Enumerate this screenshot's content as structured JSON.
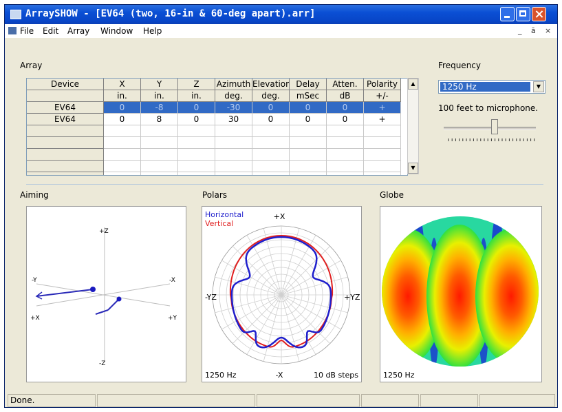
{
  "window": {
    "title": "ArraySHOW - [EV64 (two, 16-in & 60-deg apart).arr]"
  },
  "menu": [
    "File",
    "Edit",
    "Array",
    "Window",
    "Help"
  ],
  "mdi_controls": {
    "minimize": "_",
    "restore": "ā",
    "close": "×"
  },
  "array": {
    "label": "Array",
    "columns": [
      {
        "name": "Device",
        "unit": ""
      },
      {
        "name": "X",
        "unit": "in."
      },
      {
        "name": "Y",
        "unit": "in."
      },
      {
        "name": "Z",
        "unit": "in."
      },
      {
        "name": "Azimuth",
        "unit": "deg."
      },
      {
        "name": "Elevation",
        "unit": "deg."
      },
      {
        "name": "Delay",
        "unit": "mSec"
      },
      {
        "name": "Atten.",
        "unit": "dB"
      },
      {
        "name": "Polarity",
        "unit": "+/-"
      }
    ],
    "rows": [
      [
        "EV64",
        "0",
        "-8",
        "0",
        "-30",
        "0",
        "0",
        "0",
        "+"
      ],
      [
        "EV64",
        "0",
        "8",
        "0",
        "30",
        "0",
        "0",
        "0",
        "+"
      ]
    ],
    "selected_row": 0
  },
  "frequency": {
    "label": "Frequency",
    "selected": "1250 Hz",
    "distance_text": "100 feet to microphone.",
    "slider_position": 0.55
  },
  "aiming": {
    "label": "Aiming",
    "axes": {
      "pz": "+Z",
      "mz": "-Z",
      "my": "-Y",
      "py": "+Y",
      "mx": "-X",
      "px": "+X"
    }
  },
  "polars": {
    "label": "Polars",
    "legend": [
      {
        "name": "Horizontal",
        "color": "#1f1fcc"
      },
      {
        "name": "Vertical",
        "color": "#e02020"
      }
    ],
    "axis_labels": {
      "top": "+X",
      "bottom": "-X",
      "left": "-YZ",
      "right": "+YZ"
    },
    "frequency": "1250 Hz",
    "steps": "10 dB steps"
  },
  "globe": {
    "label": "Globe",
    "frequency": "1250 Hz"
  },
  "status": {
    "text": "Done."
  },
  "colors": {
    "selection": "#316ac5",
    "titlebar": "#0a4fd4",
    "window_bg": "#ece9d8"
  }
}
